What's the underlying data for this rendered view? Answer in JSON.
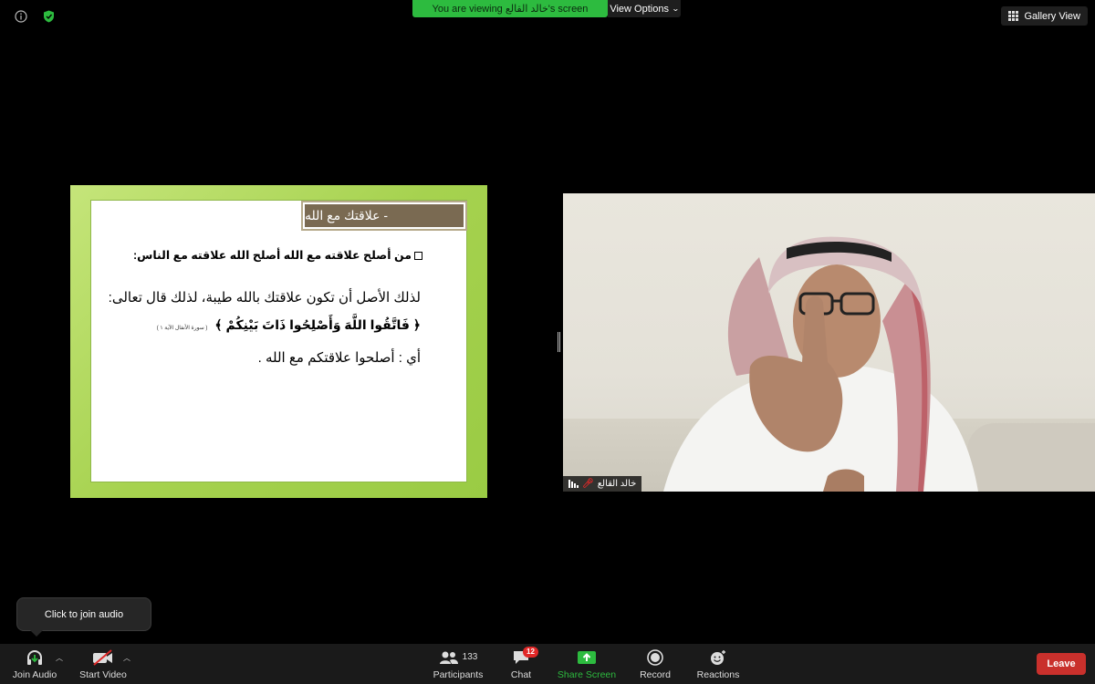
{
  "top_bar": {
    "viewing_banner": "You are viewing خالد القالع's screen",
    "view_options_label": "View Options",
    "gallery_view_label": "Gallery View"
  },
  "slide": {
    "title": "- علاقتك مع الله",
    "line1": "من أصلح علاقته مع الله أصلح الله علاقته مع الناس:",
    "line2": "لذلك الأصل أن تكون علاقتك بالله طيبة، لذلك قال تعالى:",
    "line3_verse": "﴿ فَاتَّقُوا اللَّهَ وَأَصْلِحُوا ذَاتَ بَيْنِكُمْ ﴾",
    "line3_reference": "( سورة الأنفال الآية ١ )",
    "line4": "أي : أصلحوا علاقتكم مع الله ."
  },
  "video": {
    "participant_name": "خالد القالع"
  },
  "tooltip": {
    "text": "Click to join audio"
  },
  "toolbar": {
    "join_audio": "Join Audio",
    "start_video": "Start Video",
    "participants_label": "Participants",
    "participants_count": "133",
    "chat_label": "Chat",
    "chat_badge": "12",
    "share_screen_label": "Share Screen",
    "record_label": "Record",
    "reactions_label": "Reactions",
    "leave_label": "Leave"
  },
  "colors": {
    "banner_green": "#2dbb3f",
    "leave_red": "#c9302c",
    "slide_green": "#a6d24f",
    "title_brown": "#7a6a52"
  }
}
